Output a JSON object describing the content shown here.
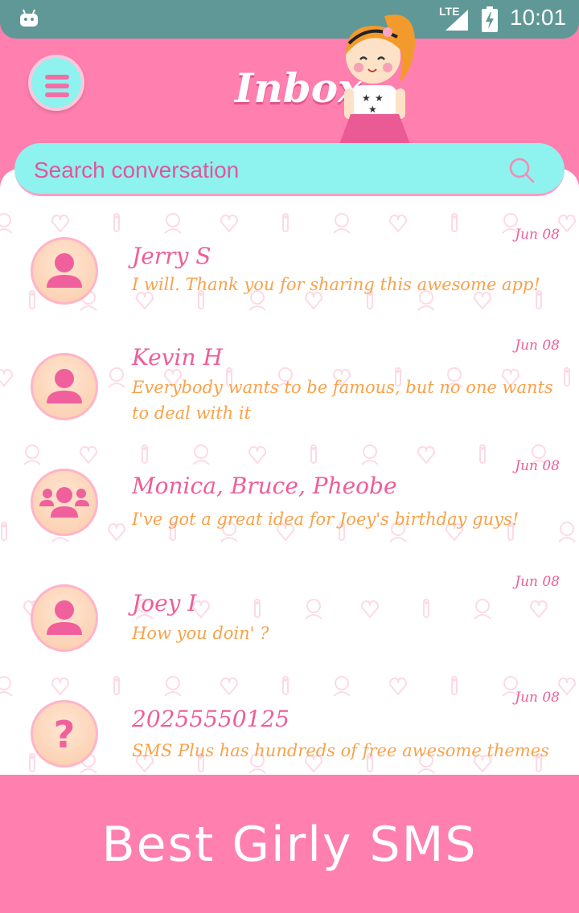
{
  "status_bar": {
    "network_label": "LTE",
    "time": "10:01",
    "icons": [
      "android-icon",
      "signal-icon",
      "battery-icon"
    ]
  },
  "header": {
    "title": "Inbox",
    "menu_icon": "hamburger-icon"
  },
  "search": {
    "placeholder": "Search conversation",
    "icon": "search-icon"
  },
  "conversations": [
    {
      "name": "Jerry S",
      "preview": "I will. Thank you for sharing this awesome app!",
      "date": "Jun 08",
      "avatar": "person-icon"
    },
    {
      "name": "Kevin H",
      "preview": "Everybody wants to be famous, but no one wants to deal with it",
      "date": "Jun 08",
      "avatar": "person-icon"
    },
    {
      "name": "Monica, Bruce, Pheobe",
      "preview": "I've got a great idea for Joey's birthday guys!",
      "date": "Jun 08",
      "avatar": "group-icon"
    },
    {
      "name": "Joey I",
      "preview": "How you doin' ?",
      "date": "Jun 08",
      "avatar": "person-icon"
    },
    {
      "name": "20255550125",
      "preview": "SMS Plus has hundreds of free awesome themes",
      "date": "Jun 08",
      "avatar": "unknown-contact-icon"
    }
  ],
  "footer": {
    "title": "Best Girly SMS"
  },
  "colors": {
    "primary_pink": "#ff7fae",
    "aqua": "#8ef2ee",
    "name_pink": "#ef5d98",
    "message_orange": "#f8a24a",
    "status_bar": "#5f9896"
  }
}
